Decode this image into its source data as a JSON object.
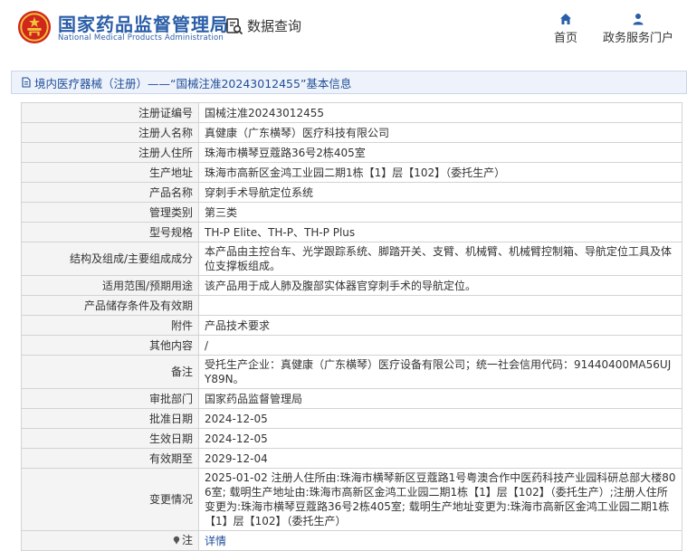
{
  "header": {
    "brand_cn": "国家药品监督管理局",
    "brand_en": "National Medical Products Administration",
    "data_query": "数据查询",
    "nav": [
      {
        "label": "首页",
        "icon": "home-icon"
      },
      {
        "label": "政务服务门户",
        "icon": "user-icon"
      }
    ]
  },
  "title_bar": {
    "text": "境内医疗器械（注册）——“国械注准20243012455”基本信息"
  },
  "rows": [
    {
      "label": "注册证编号",
      "value": "国械注准20243012455"
    },
    {
      "label": "注册人名称",
      "value": "真健康（广东横琴）医疗科技有限公司"
    },
    {
      "label": "注册人住所",
      "value": "珠海市横琴豆蔻路36号2栋405室"
    },
    {
      "label": "生产地址",
      "value": "珠海市高新区金鸿工业园二期1栋【1】层【102】（委托生产）"
    },
    {
      "label": "产品名称",
      "value": "穿刺手术导航定位系统"
    },
    {
      "label": "管理类别",
      "value": "第三类"
    },
    {
      "label": "型号规格",
      "value": "TH-P Elite、TH-P、TH-P Plus"
    },
    {
      "label": "结构及组成/主要组成成分",
      "value": "本产品由主控台车、光学跟踪系统、脚踏开关、支臂、机械臂、机械臂控制箱、导航定位工具及体位支撑板组成。"
    },
    {
      "label": "适用范围/预期用途",
      "value": "该产品用于成人肺及腹部实体器官穿刺手术的导航定位。"
    },
    {
      "label": "产品储存条件及有效期",
      "value": ""
    },
    {
      "label": "附件",
      "value": "产品技术要求"
    },
    {
      "label": "其他内容",
      "value": "/"
    },
    {
      "label": "备注",
      "value": "受托生产企业：真健康（广东横琴）医疗设备有限公司；统一社会信用代码：91440400MA56UJY89N。"
    },
    {
      "label": "审批部门",
      "value": "国家药品监督管理局"
    },
    {
      "label": "批准日期",
      "value": "2024-12-05"
    },
    {
      "label": "生效日期",
      "value": "2024-12-05"
    },
    {
      "label": "有效期至",
      "value": "2029-12-04"
    },
    {
      "label": "变更情况",
      "value": "2025-01-02 注册人住所由:珠海市横琴新区豆蔻路1号粤澳合作中医药科技产业园科研总部大楼806室; 载明生产地址由:珠海市高新区金鸿工业园二期1栋【1】层【102】（委托生产）;注册人住所变更为:珠海市横琴豆蔻路36号2栋405室; 载明生产地址变更为:珠海市高新区金鸿工业园二期1栋【1】层【102】（委托生产）"
    }
  ],
  "note": {
    "label": "注",
    "link": "详情"
  },
  "colors": {
    "brand_blue": "#2a5ea8",
    "label_bg": "#f4f4f4",
    "title_bg": "#eef3fb",
    "emblem_red": "#d0261d",
    "emblem_gold": "#f3c43a"
  }
}
